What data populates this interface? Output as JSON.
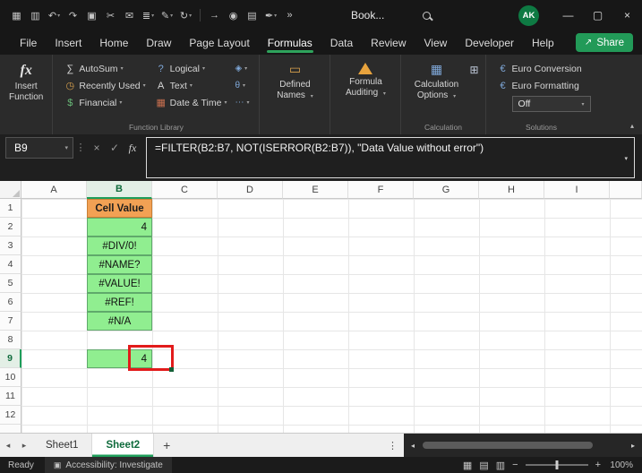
{
  "colors": {
    "accent_green": "#1E9E5A",
    "orange_fill": "#F2A154",
    "green_fill": "#90EE90",
    "highlight_red": "#E21B1B"
  },
  "ui": {
    "dropdown_glyph": "▾",
    "collapse_ribbon_glyph": "▴",
    "formula_expand_glyph": "▾",
    "dots_glyph": "⋮",
    "scroll_left": "◂",
    "scroll_right": "▸"
  },
  "title_bar": {
    "qat": [
      {
        "name": "apps-icon",
        "glyph": "▦"
      },
      {
        "name": "save-icon",
        "glyph": "▥"
      },
      {
        "name": "undo-icon",
        "glyph": "↶"
      },
      {
        "name": "redo-icon",
        "glyph": "↷"
      },
      {
        "name": "copy-icon",
        "glyph": "▣"
      },
      {
        "name": "cut-icon",
        "glyph": "✂"
      },
      {
        "name": "mail-icon",
        "glyph": "✉"
      },
      {
        "name": "numbered-list-icon",
        "glyph": "≣"
      },
      {
        "name": "format-painter-icon",
        "glyph": "✎"
      },
      {
        "name": "repeat-icon",
        "glyph": "↻"
      },
      {
        "name": "pointer-icon",
        "glyph": "→"
      },
      {
        "name": "camera-icon",
        "glyph": "◉"
      },
      {
        "name": "print-icon",
        "glyph": "▤"
      },
      {
        "name": "signature-icon",
        "glyph": "✒"
      },
      {
        "name": "more-commands-icon",
        "glyph": "»"
      }
    ],
    "title": "Book...",
    "avatar": "AK",
    "window": {
      "minimize": "—",
      "maximize": "▢",
      "close": "×"
    }
  },
  "ribbon": {
    "tabs": [
      {
        "label": "File"
      },
      {
        "label": "Insert"
      },
      {
        "label": "Home"
      },
      {
        "label": "Draw"
      },
      {
        "label": "Page Layout"
      },
      {
        "label": "Formulas"
      },
      {
        "label": "Data"
      },
      {
        "label": "Review"
      },
      {
        "label": "View"
      },
      {
        "label": "Developer"
      },
      {
        "label": "Help"
      }
    ],
    "active_tab": "Formulas",
    "share": {
      "label": "Share",
      "icon_glyph": "↗"
    },
    "insert_function": {
      "icon_glyph": "fx",
      "label_line1": "Insert",
      "label_line2": "Function"
    },
    "function_library": {
      "col1": [
        {
          "glyph": "∑",
          "label": "AutoSum"
        },
        {
          "glyph": "◷",
          "label": "Recently Used"
        },
        {
          "glyph": "$",
          "label": "Financial"
        }
      ],
      "col2": [
        {
          "glyph": "?",
          "label": "Logical"
        },
        {
          "glyph": "A",
          "label": "Text"
        },
        {
          "glyph": "▦",
          "label": "Date & Time"
        }
      ],
      "mini": [
        {
          "glyph": "◈"
        },
        {
          "glyph": "θ"
        },
        {
          "glyph": "⋯"
        }
      ],
      "group_label": "Function Library"
    },
    "defined_names": {
      "icon_glyph": "▭",
      "label": "Defined Names"
    },
    "formula_auditing": {
      "label": "Formula Auditing"
    },
    "calculation": {
      "icon_glyph": "▦",
      "label": "Calculation Options",
      "calc_sheet_glyph": "⊞",
      "group_label": "Calculation"
    },
    "solutions": {
      "items": [
        {
          "glyph": "€",
          "label": "Euro Conversion"
        },
        {
          "glyph": "€",
          "label": "Euro Formatting"
        }
      ],
      "dropdown_value": "Off",
      "group_label": "Solutions"
    }
  },
  "formula_bar": {
    "name_box": "B9",
    "cancel_glyph": "×",
    "enter_glyph": "✓",
    "fx_glyph": "fx",
    "formula": "=FILTER(B2:B7, NOT(ISERROR(B2:B7)), \"Data Value without error\")"
  },
  "grid": {
    "column_headers": [
      "A",
      "B",
      "C",
      "D",
      "E",
      "F",
      "G",
      "H",
      "I"
    ],
    "row_headers": [
      "1",
      "2",
      "3",
      "4",
      "5",
      "6",
      "7",
      "8",
      "9",
      "10",
      "11",
      "12"
    ],
    "selected_cell": "B9",
    "cells": [
      {
        "ref": "B1",
        "text": "Cell Value"
      },
      {
        "ref": "B2",
        "text": "4"
      },
      {
        "ref": "B3",
        "text": "#DIV/0!"
      },
      {
        "ref": "B4",
        "text": "#NAME?"
      },
      {
        "ref": "B5",
        "text": "#VALUE!"
      },
      {
        "ref": "B6",
        "text": "#REF!"
      },
      {
        "ref": "B7",
        "text": "#N/A"
      },
      {
        "ref": "B9",
        "text": "4"
      }
    ]
  },
  "sheet_bar": {
    "nav_left": "◂",
    "nav_right": "▸",
    "tabs": [
      {
        "label": "Sheet1"
      },
      {
        "label": "Sheet2"
      }
    ],
    "active_tab": "Sheet2",
    "add": "+",
    "dots": "⋮"
  },
  "status_bar": {
    "ready": "Ready",
    "accessibility_icon_glyph": "▣",
    "accessibility": "Accessibility: Investigate",
    "view_icons": [
      {
        "glyph": "▦"
      },
      {
        "glyph": "▤"
      },
      {
        "glyph": "▥"
      }
    ],
    "zoom_out": "−",
    "zoom_in": "+",
    "zoom": "100%"
  }
}
